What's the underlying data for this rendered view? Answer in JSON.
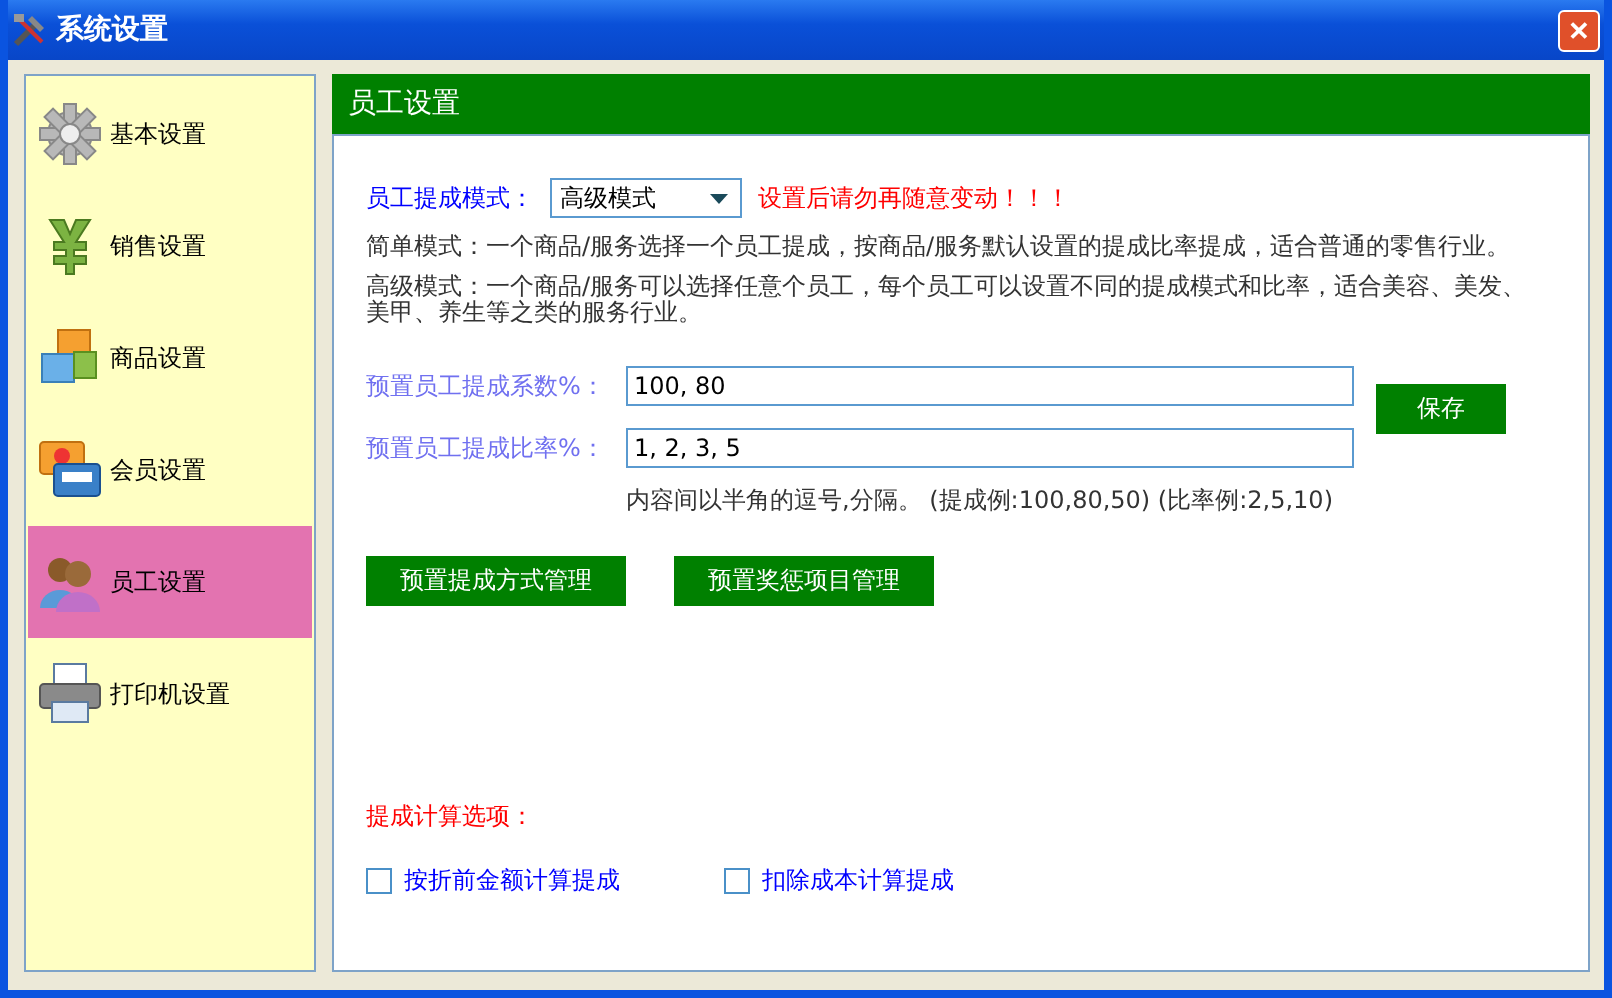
{
  "window": {
    "title": "系统设置",
    "close": "✕"
  },
  "sidebar": {
    "items": [
      {
        "label": "基本设置",
        "selected": false
      },
      {
        "label": "销售设置",
        "selected": false
      },
      {
        "label": "商品设置",
        "selected": false
      },
      {
        "label": "会员设置",
        "selected": false
      },
      {
        "label": "员工设置",
        "selected": true
      },
      {
        "label": "打印机设置",
        "selected": false
      }
    ]
  },
  "panel": {
    "title": "员工设置",
    "mode": {
      "label": "员工提成模式：",
      "value": "高级模式",
      "warning": "设置后请勿再随意变动！！！"
    },
    "descriptions": [
      "简单模式：一个商品/服务选择一个员工提成，按商品/服务默认设置的提成比率提成，适合普通的零售行业。",
      "高级模式：一个商品/服务可以选择任意个员工，每个员工可以设置不同的提成模式和比率，适合美容、美发、美甲、养生等之类的服务行业。"
    ],
    "fields": [
      {
        "label": "预置员工提成系数%：",
        "value": "100, 80"
      },
      {
        "label": "预置员工提成比率%：",
        "value": "1, 2, 3, 5"
      }
    ],
    "save_button": "保存",
    "note": "内容间以半角的逗号,分隔。 (提成例:100,80,50) (比率例:2,5,10)",
    "buttons": [
      "预置提成方式管理",
      "预置奖惩项目管理"
    ],
    "options_title": "提成计算选项：",
    "options": [
      {
        "label": "按折前金额计算提成",
        "checked": false
      },
      {
        "label": "扣除成本计算提成",
        "checked": false
      }
    ]
  }
}
